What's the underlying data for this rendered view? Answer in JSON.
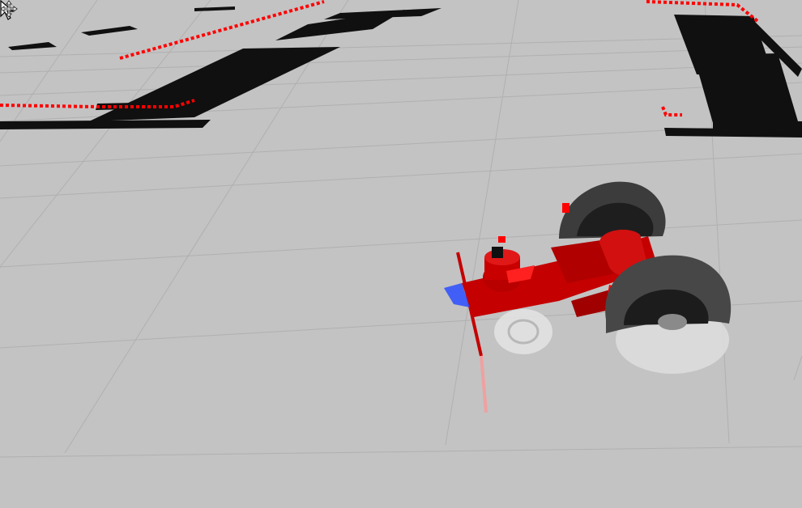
{
  "viewport": {
    "name": "3d-simulation-view",
    "colors": {
      "ground": "#c3c3c3",
      "grid_line": "#b2b2b2",
      "map_obstacle": "#111111",
      "laser_scan": "#ff0000",
      "robot_body": "#c40000",
      "robot_body_highlight": "#e81010",
      "wheel_dark": "#3a3a3a",
      "wheel_mid": "#6a6a6a",
      "caster": "#dcdcdc",
      "sensor_blue": "#2a4dff"
    }
  },
  "scene": {
    "robot_model": "differential-drive-robot",
    "cursor_icon": "arrow-cursor-icon",
    "move_icon": "move-crosshair-icon"
  }
}
